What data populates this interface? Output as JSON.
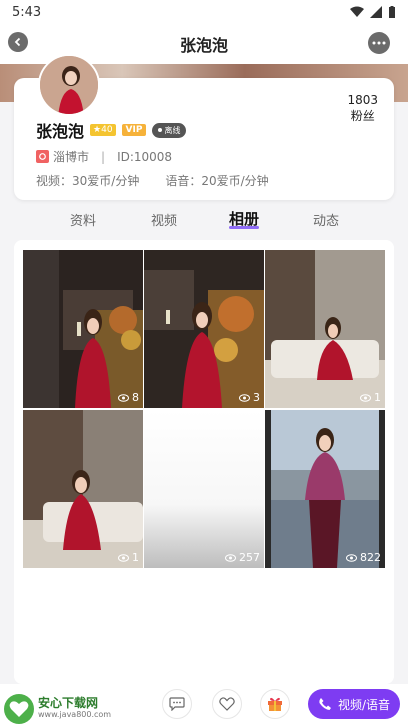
{
  "statusbar": {
    "time": "5:43"
  },
  "header": {
    "title": "张泡泡"
  },
  "profile": {
    "name": "张泡泡",
    "level": "40",
    "vip": "VIP",
    "status": "离线",
    "location": "淄博市",
    "id_text": "ID:10008",
    "separator": "|",
    "video_price": "视频：30爱币/分钟",
    "voice_price": "语音：20爱币/分钟",
    "fans_count": "1803",
    "fans_label": "粉丝"
  },
  "tabs": [
    "资料",
    "视频",
    "相册",
    "动态"
  ],
  "active_tab": 2,
  "album": [
    {
      "views": "8"
    },
    {
      "views": "3"
    },
    {
      "views": "1"
    },
    {
      "views": "1"
    },
    {
      "views": "257"
    },
    {
      "views": "822"
    }
  ],
  "bottom": {
    "call_label": "视频/语音"
  },
  "watermark": {
    "title": "安心下载网",
    "url": "www.java800.com"
  },
  "colors": {
    "accent": "#7e3cf2",
    "underline": "#8f6cf6",
    "vip": "#f6b23a",
    "location": "#f06262"
  }
}
